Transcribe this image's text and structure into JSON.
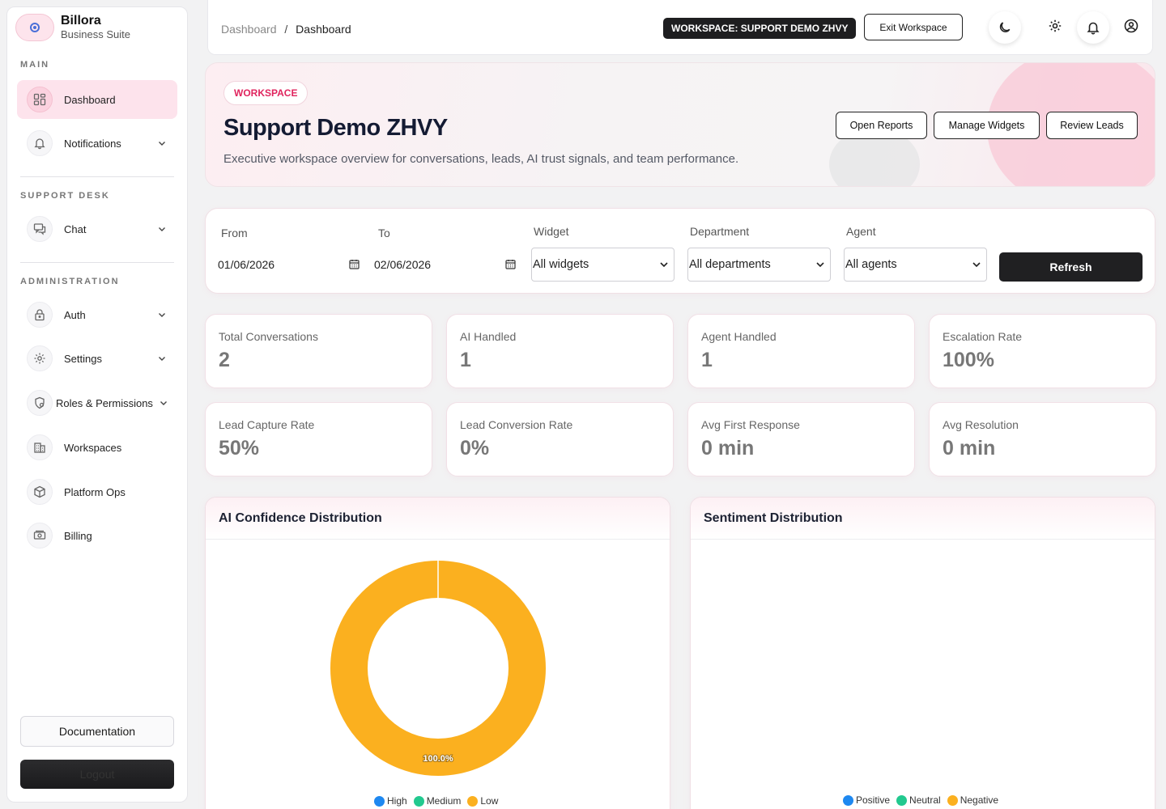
{
  "brand": {
    "name": "Billora",
    "subtitle": "Business Suite"
  },
  "sidebar": {
    "sections": [
      {
        "title": "MAIN"
      },
      {
        "title": "SUPPORT DESK"
      },
      {
        "title": "ADMINISTRATION"
      }
    ],
    "items": [
      {
        "label": "Dashboard",
        "icon": "dashboard-grid-icon",
        "active": true
      },
      {
        "label": "Notifications",
        "icon": "bell-icon",
        "expandable": true
      },
      {
        "label": "Chat",
        "icon": "chat-icon",
        "expandable": true
      },
      {
        "label": "Auth",
        "icon": "lock-icon",
        "expandable": true
      },
      {
        "label": "Settings",
        "icon": "gear-icon",
        "expandable": true
      },
      {
        "label": "Roles & Permissions",
        "icon": "shield-user-icon",
        "expandable": true
      },
      {
        "label": "Workspaces",
        "icon": "building-icon"
      },
      {
        "label": "Platform Ops",
        "icon": "cube-icon"
      },
      {
        "label": "Billing",
        "icon": "cash-icon"
      }
    ],
    "documentation_label": "Documentation",
    "logout_label": "Logout"
  },
  "topbar": {
    "breadcrumb_root": "Dashboard",
    "breadcrumb_sep": "/",
    "breadcrumb_current": "Dashboard",
    "workspace_pill": "WORKSPACE: SUPPORT DEMO ZHVY",
    "exit_label": "Exit Workspace",
    "icons": [
      "moon-icon",
      "gear-icon",
      "bell-icon",
      "user-circle-icon"
    ]
  },
  "hero": {
    "badge": "WORKSPACE",
    "title": "Support Demo ZHVY",
    "subtitle": "Executive workspace overview for conversations, leads, AI trust signals, and team performance.",
    "buttons": [
      "Open Reports",
      "Manage Widgets",
      "Review Leads"
    ]
  },
  "filters": {
    "from_label": "From",
    "from_value": "01/06/2026",
    "to_label": "To",
    "to_value": "02/06/2026",
    "widget_label": "Widget",
    "widget_value": "All widgets",
    "department_label": "Department",
    "department_value": "All departments",
    "agent_label": "Agent",
    "agent_value": "All agents",
    "refresh_label": "Refresh"
  },
  "stats": [
    {
      "label": "Total Conversations",
      "value": "2"
    },
    {
      "label": "AI Handled",
      "value": "1"
    },
    {
      "label": "Agent Handled",
      "value": "1"
    },
    {
      "label": "Escalation Rate",
      "value": "100%"
    },
    {
      "label": "Lead Capture Rate",
      "value": "50%"
    },
    {
      "label": "Lead Conversion Rate",
      "value": "0%"
    },
    {
      "label": "Avg First Response",
      "value": "0 min"
    },
    {
      "label": "Avg Resolution",
      "value": "0 min"
    }
  ],
  "colors": {
    "accent": "#e0245e",
    "high": "#1e88f0",
    "medium": "#22c98f",
    "low": "#fbb01f",
    "positive": "#1e88f0",
    "neutral": "#22c98f",
    "negative": "#fbb01f"
  },
  "chart_data": [
    {
      "type": "pie",
      "title": "AI Confidence Distribution",
      "categories": [
        "High",
        "Medium",
        "Low"
      ],
      "values": [
        0,
        0,
        100
      ],
      "data_labels": [
        "",
        "",
        "100.0%"
      ],
      "donut": true,
      "legend": "bottom"
    },
    {
      "type": "pie",
      "title": "Sentiment Distribution",
      "categories": [
        "Positive",
        "Neutral",
        "Negative"
      ],
      "values": [
        0,
        0,
        0
      ],
      "legend": "bottom"
    }
  ]
}
